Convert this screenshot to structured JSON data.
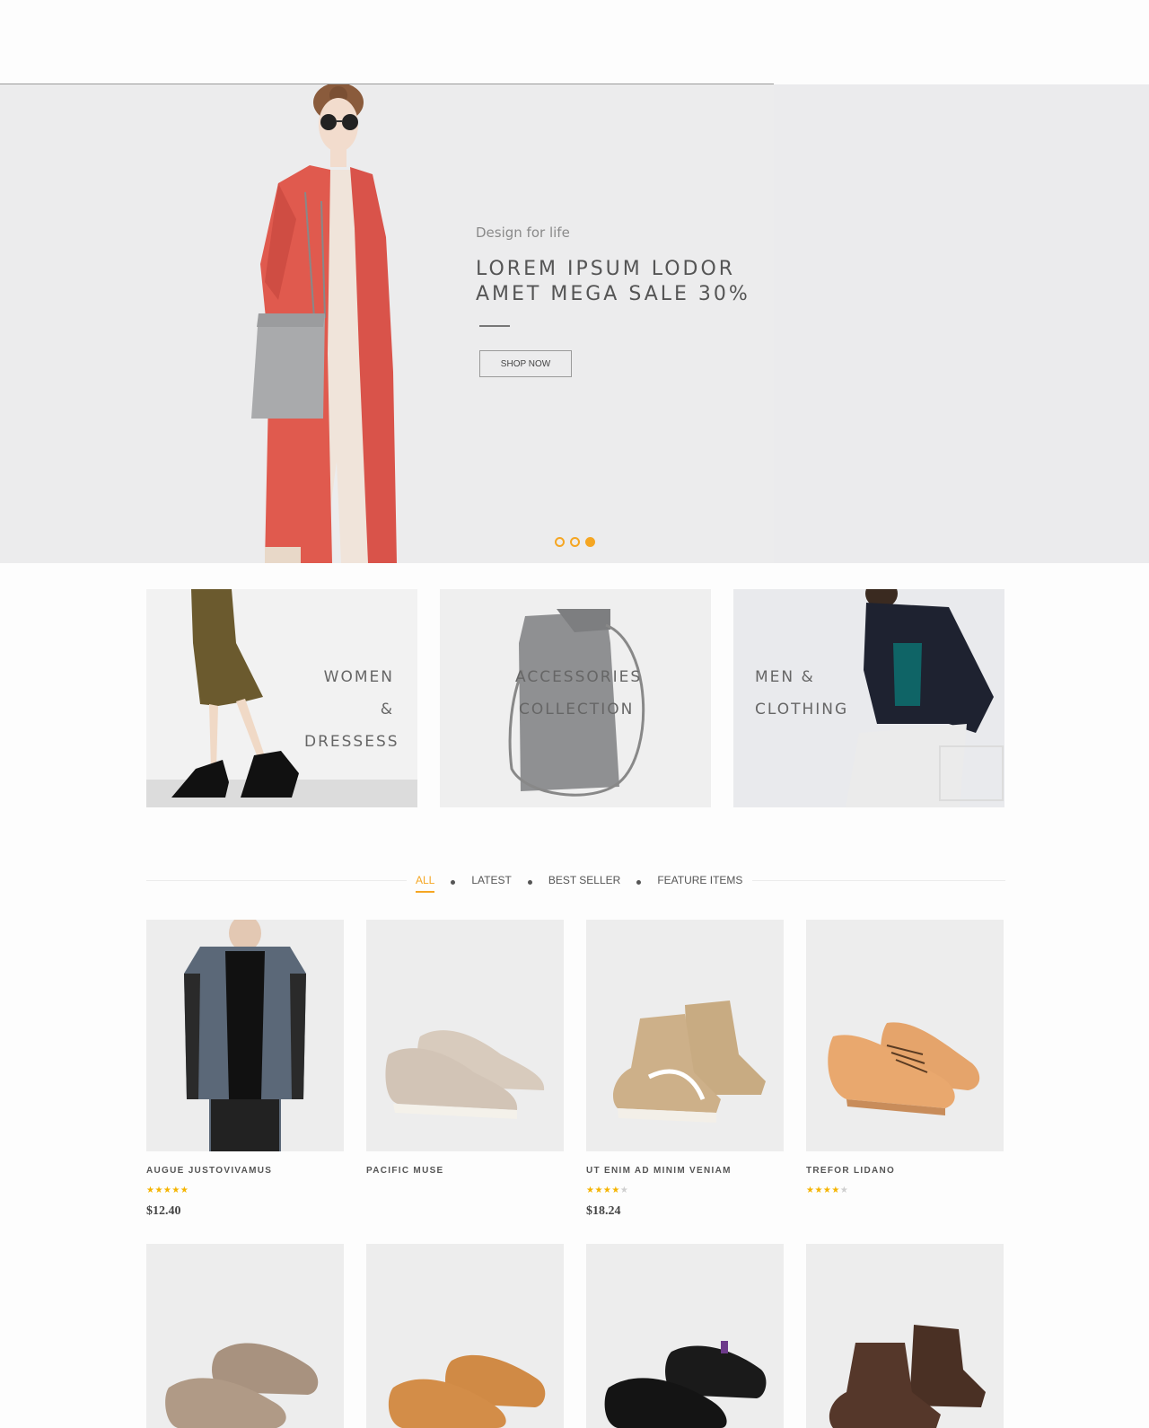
{
  "hero": {
    "kicker": "Design for life",
    "title_line1": "LOREM IPSUM LODOR",
    "title_line2": "AMET MEGA SALE 30%",
    "button_label": "SHOP NOW",
    "slides": 3,
    "active_slide": 3
  },
  "categories": [
    {
      "line1": "WOMEN &",
      "line2": "DRESSESS"
    },
    {
      "line1": "ACCESSORIES",
      "line2": "COLLECTION"
    },
    {
      "line1": "MEN &",
      "line2": "CLOTHING"
    }
  ],
  "filter": {
    "items": [
      "ALL",
      "LATEST",
      "BEST SELLER",
      "FEATURE ITEMS"
    ],
    "active": "ALL"
  },
  "products": [
    {
      "name": "AUGUE JUSTOVIVAMUS",
      "rating": 5,
      "price": "$12.40",
      "image": "denim-jacket"
    },
    {
      "name": "PACIFIC MUSE",
      "rating": 0,
      "price": "",
      "image": "beige-slip-on"
    },
    {
      "name": "UT ENIM AD MINIM VENIAM",
      "rating": 4,
      "price": "$18.24",
      "image": "tan-high-top"
    },
    {
      "name": "TREFOR LIDANO",
      "rating": 4,
      "price": "",
      "image": "tan-leather-shoe"
    }
  ],
  "products_row2": [
    {
      "image": "taupe-sneaker"
    },
    {
      "image": "tan-sneaker"
    },
    {
      "image": "black-sneaker"
    },
    {
      "image": "brown-boot"
    }
  ],
  "colors": {
    "accent": "#f5a623",
    "coat": "#e05a4e",
    "bag": "#a9aaac"
  }
}
